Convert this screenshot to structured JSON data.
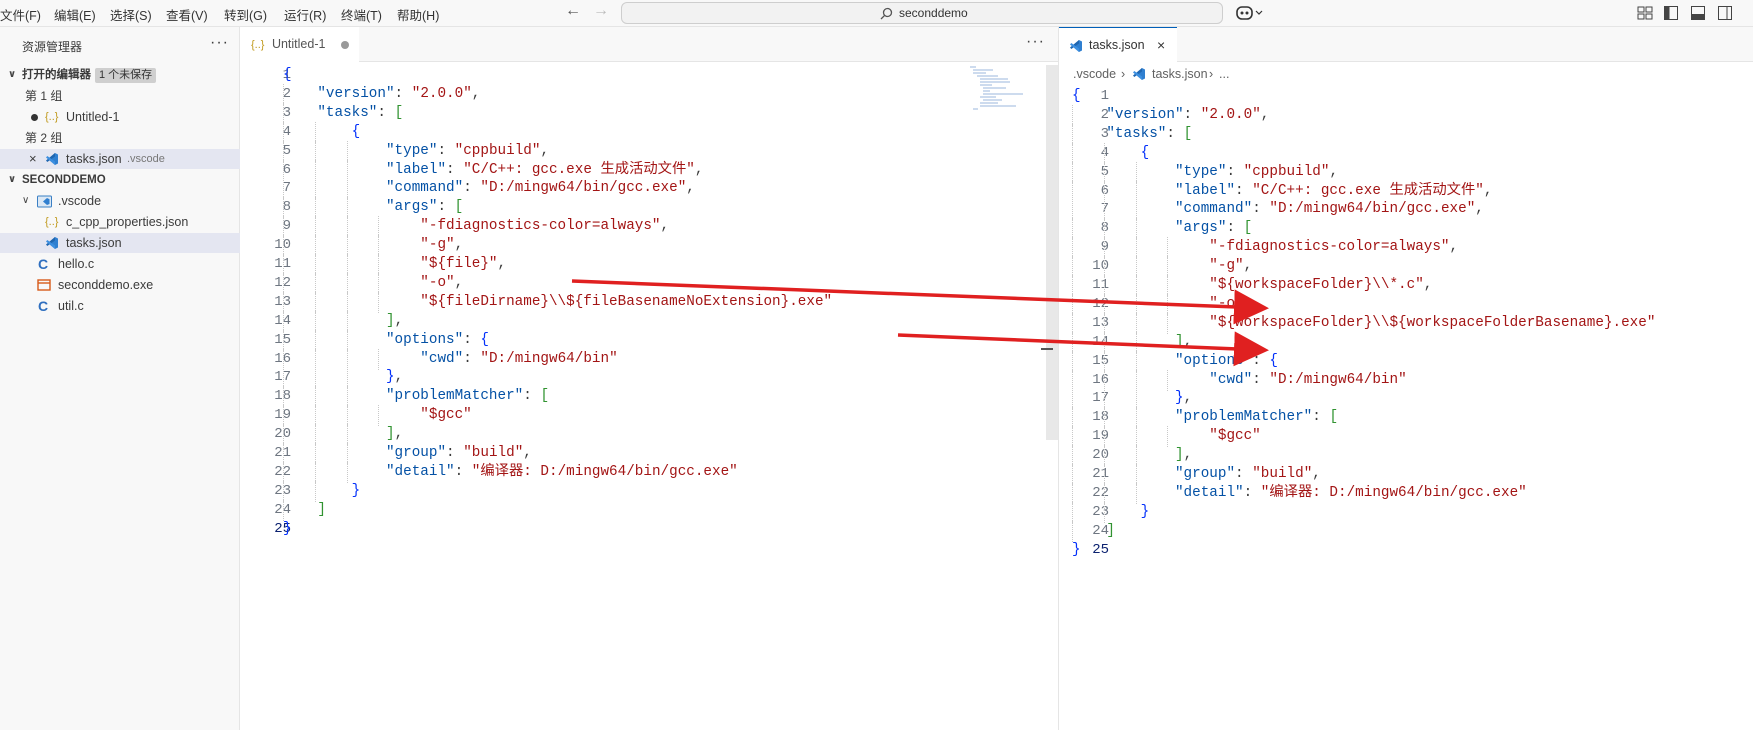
{
  "menu": [
    "文件(F)",
    "编辑(E)",
    "选择(S)",
    "查看(V)",
    "转到(G)",
    "运行(R)",
    "终端(T)",
    "帮助(H)"
  ],
  "search": {
    "text": "seconddemo"
  },
  "explorer": {
    "title": "资源管理器",
    "open_editors": "打开的编辑器",
    "unsaved_badge": "1 个未保存",
    "group1": "第 1 组",
    "group1_file": "Untitled-1",
    "group2": "第 2 组",
    "group2_file": "tasks.json",
    "group2_path": ".vscode",
    "workspace": "SECONDDEMO",
    "folder": ".vscode",
    "files": [
      "c_cpp_properties.json",
      "tasks.json",
      "hello.c",
      "seconddemo.exe",
      "util.c"
    ]
  },
  "left_tab": {
    "title": "Untitled-1"
  },
  "right_tab": {
    "title": "tasks.json"
  },
  "breadcrumb": {
    "folder": ".vscode",
    "file": "tasks.json",
    "more": "..."
  },
  "left_code": [
    "{",
    "    \"version\": \"2.0.0\",",
    "    \"tasks\": [",
    "        {",
    "            \"type\": \"cppbuild\",",
    "            \"label\": \"C/C++: gcc.exe 生成活动文件\",",
    "            \"command\": \"D:/mingw64/bin/gcc.exe\",",
    "            \"args\": [",
    "                \"-fdiagnostics-color=always\",",
    "                \"-g\",",
    "                \"${file}\",",
    "                \"-o\",",
    "                \"${fileDirname}\\\\${fileBasenameNoExtension}.exe\"",
    "            ],",
    "            \"options\": {",
    "                \"cwd\": \"D:/mingw64/bin\"",
    "            },",
    "            \"problemMatcher\": [",
    "                \"$gcc\"",
    "            ],",
    "            \"group\": \"build\",",
    "            \"detail\": \"编译器: D:/mingw64/bin/gcc.exe\"",
    "        }",
    "    ]",
    "}"
  ],
  "right_code": [
    "{",
    "    \"version\": \"2.0.0\",",
    "    \"tasks\": [",
    "        {",
    "            \"type\": \"cppbuild\",",
    "            \"label\": \"C/C++: gcc.exe 生成活动文件\",",
    "            \"command\": \"D:/mingw64/bin/gcc.exe\",",
    "            \"args\": [",
    "                \"-fdiagnostics-color=always\",",
    "                \"-g\",",
    "                \"${workspaceFolder}\\\\*.c\",",
    "                \"-o\",",
    "                \"${workspaceFolder}\\\\${workspaceFolderBasename}.exe\"",
    "            ],",
    "            \"options\": {",
    "                \"cwd\": \"D:/mingw64/bin\"",
    "            },",
    "            \"problemMatcher\": [",
    "                \"$gcc\"",
    "            ],",
    "            \"group\": \"build\",",
    "            \"detail\": \"编译器: D:/mingw64/bin/gcc.exe\"",
    "        }",
    "    ]",
    "}"
  ],
  "colors": {
    "key": "#0451a5",
    "string": "#a31515",
    "arrow": "#e02020"
  }
}
